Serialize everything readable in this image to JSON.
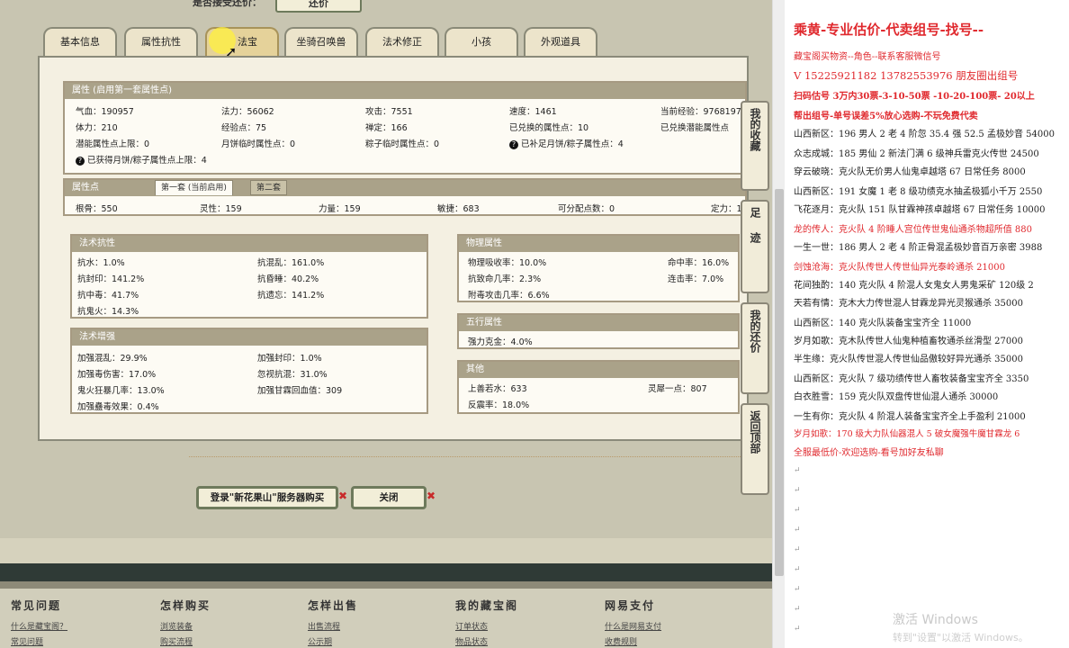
{
  "header": {
    "prompt": "是否接受还价：",
    "button": "还价"
  },
  "tabs": [
    "基本信息",
    "属性抗性",
    "法宝",
    "坐骑召唤兽",
    "法术修正",
    "小孩",
    "外观道具"
  ],
  "attr": {
    "title": "属性 (启用第一套属性点)",
    "r1": [
      "气血：190957",
      "法力：56062",
      "攻击：7551",
      "速度：1461",
      "当前经验：9768197"
    ],
    "r2": [
      "体力：210",
      "经验点：75",
      "禅定：166",
      "已兑换的属性点：10",
      "已兑换潜能属性点"
    ],
    "r3": [
      "潜能属性点上限：0",
      "月饼临时属性点：0",
      "粽子临时属性点：0",
      "已补足月饼/粽子属性点：4"
    ],
    "r4": "已获得月饼/粽子属性点上限：4"
  },
  "points": {
    "title": "属性点",
    "tab1": "第一套 (当前启用)",
    "tab2": "第二套",
    "row": [
      "根骨：550",
      "灵性：159",
      "力量：159",
      "敏捷：683",
      "可分配点数：0",
      "定力：1"
    ]
  },
  "resist": {
    "title": "法术抗性",
    "left": [
      "抗水：1.0%",
      "抗封印：141.2%",
      "抗中毒：41.7%",
      "抗鬼火：14.3%"
    ],
    "right": [
      "抗混乱：161.0%",
      "抗昏睡：40.2%",
      "抗遗忘：141.2%"
    ]
  },
  "boost": {
    "title": "法术增强",
    "left": [
      "加强混乱：29.9%",
      "加强毒伤害：17.0%",
      "鬼火狂暴几率：13.0%",
      "加强蠱毒效果：0.4%"
    ],
    "right": [
      "加强封印：1.0%",
      "忽视抗混：31.0%",
      "加强甘霖回血值：309"
    ]
  },
  "phys": {
    "title": "物理属性",
    "left": [
      "物理吸收率：10.0%",
      "抗致命几率：2.3%",
      "附毒攻击几率：6.6%"
    ],
    "right": [
      "命中率：16.0%",
      "连击率：7.0%"
    ]
  },
  "wuxing": {
    "title": "五行属性",
    "v": "强力克金：4.0%"
  },
  "other": {
    "title": "其他",
    "left": [
      "上善若水：633",
      "反震率：18.0%"
    ],
    "right": [
      "灵犀一点：807"
    ]
  },
  "buttons": {
    "buy": "登录\"新花果山\"服务器购买",
    "close": "关闭"
  },
  "sidenav": [
    "我的收藏",
    "足迹",
    "我的还价",
    "返回顶部"
  ],
  "footer": [
    {
      "t": "常见问题",
      "l": "什么是藏宝阁？",
      "l2": "常见问题"
    },
    {
      "t": "怎样购买",
      "l": "浏览装备",
      "l2": "购买流程"
    },
    {
      "t": "怎样出售",
      "l": "出售流程",
      "l2": "公示期"
    },
    {
      "t": "我的藏宝阁",
      "l": "订单状态",
      "l2": "物品状态"
    },
    {
      "t": "网易支付",
      "l": "什么是网易支付",
      "l2": "收费规则"
    }
  ],
  "right": {
    "title": "乘黄-专业估价-代卖组号-找号--",
    "lines": [
      "藏宝阁买物资--角色--联系客服微信号",
      "V 15225921182   13782553976 朋友圈出组号",
      "扫码估号 3万内30票-3-10-50票  -10-20-100票- 20以上",
      "帮出组号-单号误差5%放心选购-不玩免费代卖",
      "山西新区：196 男人 2 老 4 阶忽 35.4 强 52.5 孟极妙音 54000",
      "众志成城：185 男仙 2 新法门满 6 级神兵雷克火传世 24500",
      "穿云破晓：克火队无价男人仙鬼卓越塔 67 日常任务 8000",
      "山西新区：191 女魔 1 老 8 级功绩克水抽孟极狐小千万 2550",
      "飞花逐月：克火队 151 队甘霖神孩卓越塔 67 日常任务 10000",
      "龙的传人：克火队 4 阶睡人宫位传世鬼仙通杀物超所值 880",
      "一生一世：186 男人 2 老 4 阶正骨混孟极妙音百万亲密 3988",
      "剑蚀沧海：克火队传世人传世仙异光泰岭通杀 21000",
      "花间独酌：140 克火队 4 阶混人女鬼女人男鬼采矿 120级 2",
      "天若有情：克木大力传世混人甘霖龙异光灵猴通杀 35000",
      "山西新区：140 克火队装备宝宝齐全 11000",
      "岁月如歌：克木队传世人仙鬼种植畜牧通杀丝滑型 27000",
      "半生缘：克火队传世混人传世仙品傲较好异光通杀 35000",
      "山西新区：克火队 7 级功绩传世人畜牧装备宝宝齐全 3350",
      "白衣胜雪：159 克火队双盘传世仙混人通杀 30000",
      "一生有你：克火队 4 阶混人装备宝宝齐全上手盈利 21000",
      "岁月如歌：170 级大力队仙器混人 5 破女魔强牛魔甘霖龙 6",
      "全服最低价-欢迎选购-看号加好友私聊"
    ],
    "watermark": "激活 Windows",
    "watermark2": "转到\"设置\"以激活 Windows。"
  }
}
